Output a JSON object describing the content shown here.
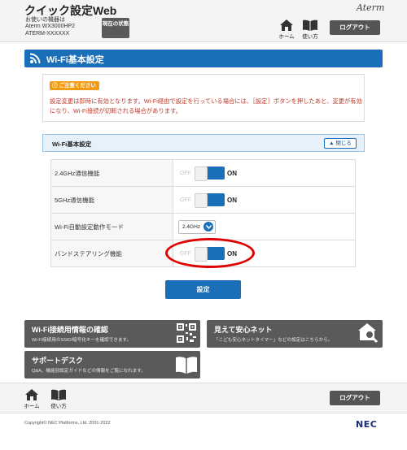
{
  "header": {
    "app_title": "クイック設定Web",
    "device_label": "お使いの機器は",
    "device_model": "Aterm WX3000HP2",
    "device_id": "ATERM-XXXXXX",
    "status_button": "現在の状態",
    "brand": "Aterm",
    "home_label": "ホーム",
    "help_label": "使い方",
    "logout_label": "ログアウト"
  },
  "section": {
    "title": "Wi-Fi基本設定",
    "icon": "wifi-icon"
  },
  "notice": {
    "badge": "ご注意ください",
    "text": "設定変更は即時に有効となります。Wi-Fi経由で設定を行っている場合には、［設定］ボタンを押したあと、変更が有効になり、Wi-Fi接続が切断される場合があります。",
    "color": "#c0392b",
    "badge_color": "#f39c12"
  },
  "panel": {
    "title": "Wi-Fi基本設定",
    "collapse_label": "閉じる"
  },
  "settings": {
    "rows": [
      {
        "label": "2.4GHz通信機能",
        "off": "OFF",
        "on": "ON",
        "state": "ON"
      },
      {
        "label": "5GHz通信機能",
        "off": "OFF",
        "on": "ON",
        "state": "ON"
      },
      {
        "label": "Wi-Fi自動設定動作モード",
        "select_value": "2.4GHz"
      },
      {
        "label": "バンドステアリング機能",
        "off": "OFF",
        "on": "ON",
        "state": "ON"
      }
    ]
  },
  "submit_label": "設定",
  "cards": {
    "wifi_info": {
      "title": "Wi-Fi接続用情報の確認",
      "desc": "Wi-Fi接続用のSSID/暗号化キーを確認できます。",
      "icon": "qr-code-icon"
    },
    "safe_net": {
      "title": "見えて安心ネット",
      "desc": "「こども安心ネットタイマー」などの設定はこちらから。",
      "icon": "house-magnifier-icon"
    },
    "support": {
      "title": "サポートデスク",
      "desc": "Q&A、機能別設定ガイドなどの情報をご覧になれます。",
      "icon": "book-icon"
    }
  },
  "footer": {
    "home_label": "ホーム",
    "help_label": "使い方",
    "logout_label": "ログアウト",
    "copyright": "Copyright© NEC Platforms, Ltd. 2001-2022",
    "logo": "NEC"
  },
  "colors": {
    "accent": "#1a6fb8",
    "dark_button": "#555555",
    "highlight": "#e00000"
  }
}
